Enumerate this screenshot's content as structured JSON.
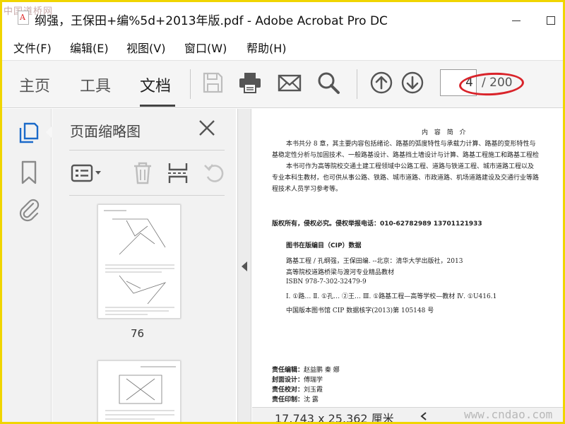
{
  "window": {
    "title": "纲强，王保田+编%5d+2013年版.pdf - Adobe Acrobat Pro DC",
    "watermark_top_left": "中国道桥网"
  },
  "menu": [
    {
      "label": "文件(F)"
    },
    {
      "label": "编辑(E)"
    },
    {
      "label": "视图(V)"
    },
    {
      "label": "窗口(W)"
    },
    {
      "label": "帮助(H)"
    }
  ],
  "toolbar": {
    "tabs": [
      {
        "label": "主页",
        "active": false
      },
      {
        "label": "工具",
        "active": false
      },
      {
        "label": "文档",
        "active": true
      }
    ],
    "icons": [
      "save-icon",
      "print-icon",
      "email-icon",
      "search-icon",
      "previous-page-icon",
      "next-page-icon"
    ],
    "current_page": "4",
    "total_pages": "/ 200",
    "annotation_color": "#d9232a"
  },
  "rail": {
    "icons": [
      "page-thumbnails-icon",
      "bookmarks-icon",
      "attachments-icon"
    ],
    "accent": "#1b6ac9"
  },
  "thumbnail_panel": {
    "title": "页面缩略图",
    "tools": [
      "thumbnail-options-icon",
      "delete-icon",
      "extract-icon",
      "undo-icon"
    ],
    "page_labels": [
      "76"
    ]
  },
  "document": {
    "heading": "内 容 简 介",
    "paragraphs": [
      "本书共分 8 章，其主要内容包括绪论、路基的弧度特性与承载力计算、路基的变形特性与",
      "基稳定性分析与加固技术、一般路基设计、路基挡土墙设计与计算、路基工程施工和路基工程检",
      "本书可作为高等院校交通土建工程领域中公路工程、道路与铁道工程、城市道路工程以及",
      "专业本科生教材，也可供从事公路、铁路、城市道路、市政道路、机场道路建设及交通行业等路",
      "程技术人员学习参考等。"
    ],
    "copyright": "版权所有，侵权必究。侵权举报电话：010-62782989   13701121933",
    "cip_title": "图书在版编目（CIP）数据",
    "cip_lines": [
      "路基工程 / 孔纲强，王保田编. --北京：清华大学出版社，2013",
      "高等院校道路桥梁与渡河专业精品教材",
      "ISBN 978-7-302-32479-9"
    ],
    "classification": "Ⅰ. ①路…  Ⅱ. ①孔…  ②王…   Ⅲ. ①路基工程—高等学校—教材  Ⅳ. ①U416.1",
    "cip_number": "中国版本图书馆 CIP 数据核字(2013)第 105148 号",
    "credits": [
      {
        "role": "责任编辑：",
        "name": "赵益鹏   秦  娜"
      },
      {
        "role": "封面设计：",
        "name": "傅瑞学"
      },
      {
        "role": "责任校对：",
        "name": "刘玉霞"
      },
      {
        "role": "责任印制：",
        "name": "沈  露"
      }
    ]
  },
  "status": {
    "page_size": "17.743 x 25.362 厘米",
    "watermark": "www.cndao.com"
  }
}
